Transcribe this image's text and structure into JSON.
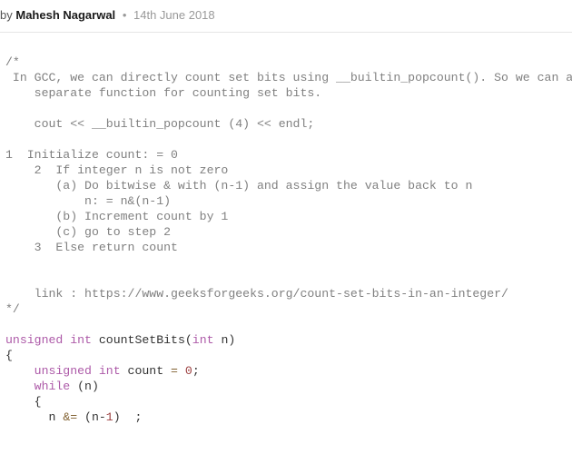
{
  "meta": {
    "by": "by",
    "author": "Mahesh Nagarwal",
    "date": "14th June 2018"
  },
  "code": {
    "comment_open": "/*",
    "comment_body": "\n In GCC, we can directly count set bits using __builtin_popcount(). So we can av\n    separate function for counting set bits.\n\n    cout << __builtin_popcount (4) << endl;\n\n1  Initialize count: = 0\n    2  If integer n is not zero\n       (a) Do bitwise & with (n-1) and assign the value back to n\n           n: = n&(n-1)\n       (b) Increment count by 1\n       (c) go to step 2\n    3  Else return count\n\n\n    link : https://www.geeksforgeeks.org/count-set-bits-in-an-integer/\n",
    "comment_close": "*/",
    "kw_unsigned": "unsigned",
    "kw_int": "int",
    "fn_name": " countSetBits(",
    "param_close": " n)",
    "brace_open": "{",
    "sp4": "    ",
    "var_decl_mid": " count ",
    "eq": "=",
    "sp": " ",
    "zero": "0",
    "one": "1",
    "semi": ";",
    "kw_while": "while",
    "while_cond": " (n)",
    "inner_sp": "      ",
    "n_var": "n ",
    "and_eq": "&=",
    "paren_open": " (n-",
    "paren_close_sp_semi": ")  ;"
  }
}
